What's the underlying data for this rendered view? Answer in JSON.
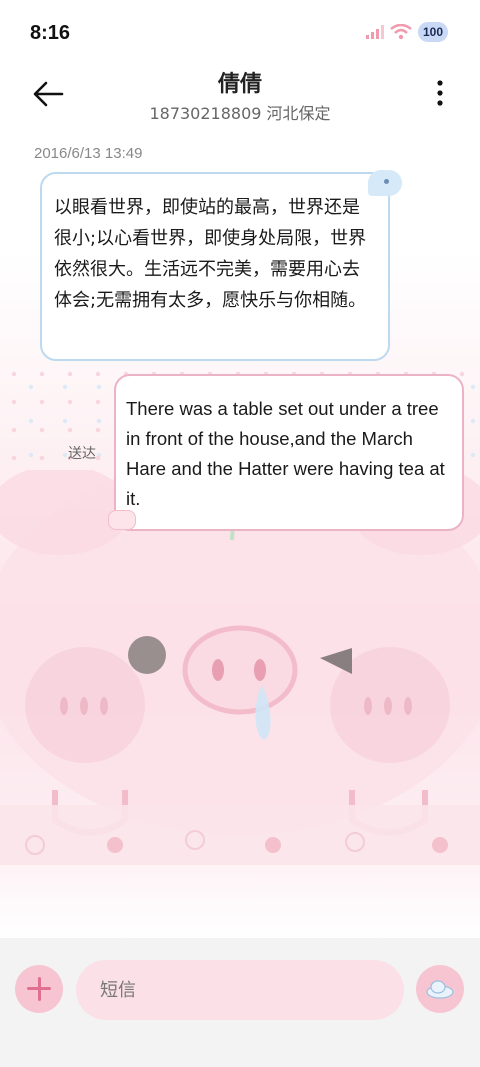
{
  "status_bar": {
    "time": "8:16",
    "battery": "100"
  },
  "header": {
    "contact_name": "倩倩",
    "contact_sub": "18730218809 河北保定",
    "back_icon": "arrow-left-icon",
    "more_icon": "more-vertical-icon"
  },
  "conversation": {
    "timestamp": "2016/6/13 13:49",
    "messages": [
      {
        "direction": "incoming",
        "text": "以眼看世界，即使站的最高，世界还是很小;以心看世界，即使身处局限，世界依然很大。生活远不完美，需要用心去体会;无需拥有太多，愿快乐与你相随。"
      },
      {
        "direction": "outgoing",
        "text": "There was a table set out under a tree in front of the house,and the March Hare and the Hatter were having tea at it.",
        "status": "送达"
      }
    ]
  },
  "composer": {
    "placeholder": "短信",
    "add_icon": "plus-icon",
    "send_icon": "send-cloud-icon"
  },
  "colors": {
    "accent_pink": "#f7c5d2",
    "incoming_border": "#bcd9ef",
    "outgoing_border": "#ecb3c4"
  }
}
